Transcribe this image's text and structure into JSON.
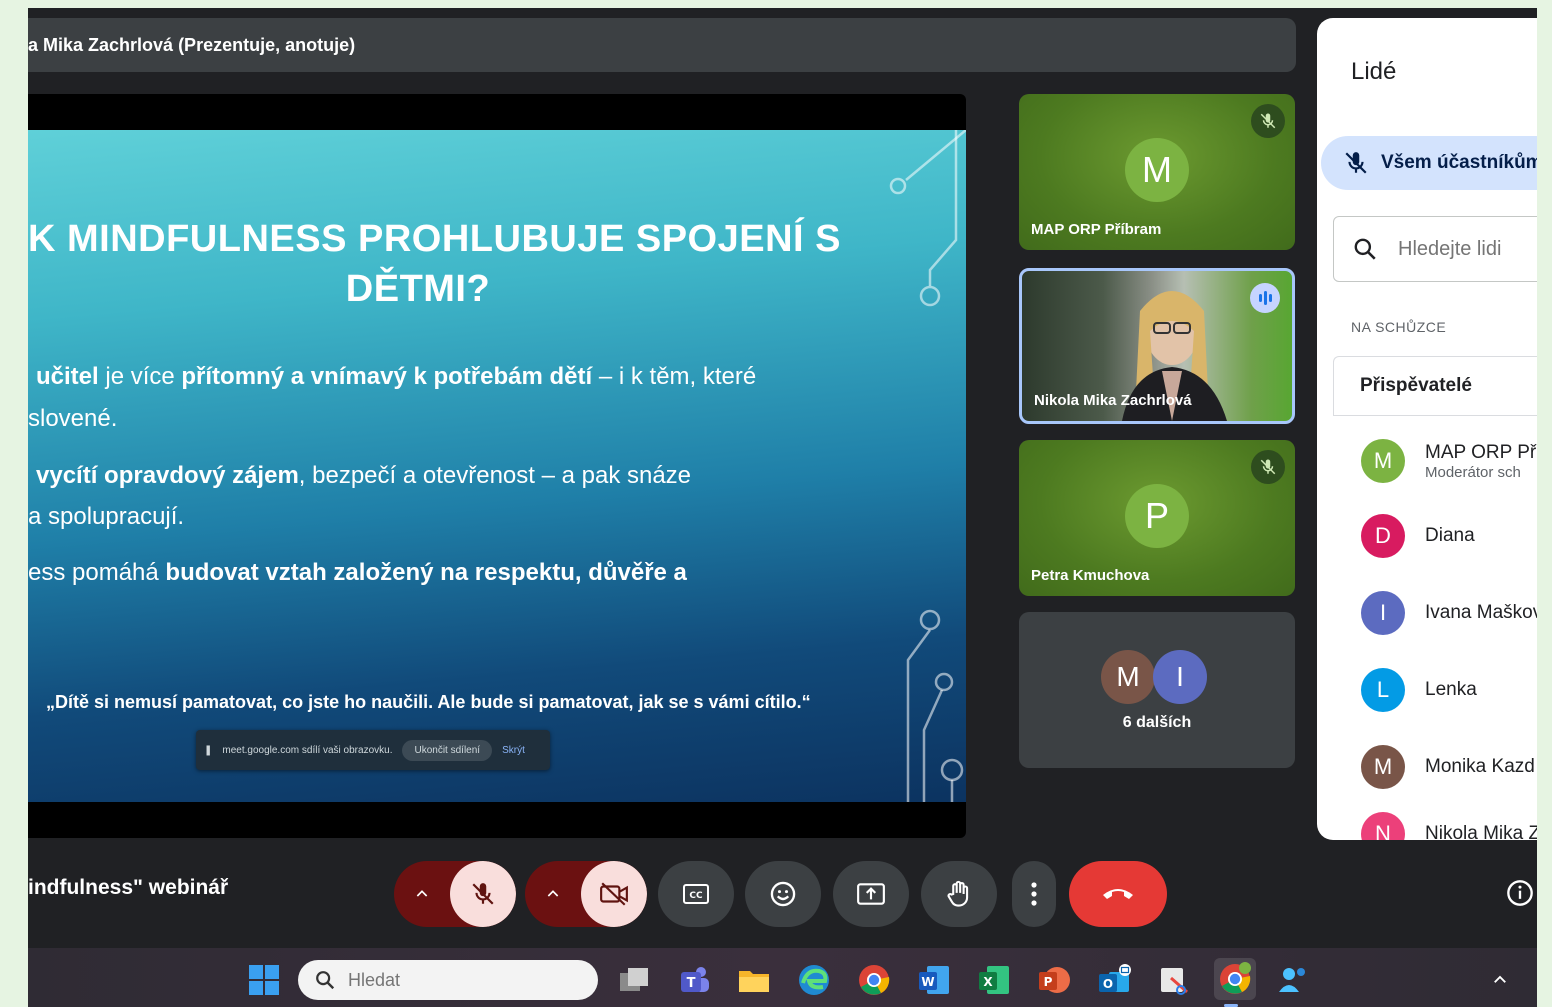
{
  "presenter_bar": {
    "text": "a Mika Zachrlová (Prezentuje, anotuje)"
  },
  "slide": {
    "title_line1": "K MINDFULNESS PROHLUBUJE SPOJENÍ S",
    "title_line2": "DĚTMI?",
    "bullets": [
      {
        "parts": [
          {
            "t": "učitel",
            "b": true
          },
          {
            "t": " je více ",
            "b": false
          },
          {
            "t": "přítomný a vnímavý k potřebám dětí",
            "b": true
          },
          {
            "t": " – i k těm, které",
            "b": false
          }
        ]
      },
      {
        "parts": [
          {
            "t": "slovené.",
            "b": false
          }
        ]
      },
      {
        "parts": [
          {
            "t": "vycítí opravdový zájem",
            "b": true
          },
          {
            "t": ", bezpečí a otevřenost – a pak snáze",
            "b": false
          }
        ]
      },
      {
        "parts": [
          {
            "t": "a spolupracují.",
            "b": false
          }
        ]
      },
      {
        "parts": [
          {
            "t": "ess pomáhá ",
            "b": false
          },
          {
            "t": "budovat vztah založený na respektu, důvěře a",
            "b": true
          }
        ]
      }
    ],
    "quote": "„Dítě si nemusí pamatovat, co jste ho naučili. Ale bude si pamatovat, jak se s vámi cítilo.“",
    "share_banner": {
      "text": "meet.google.com sdílí vaši obrazovku.",
      "stop_label": "Ukončit sdílení",
      "hide_label": "Skrýt"
    }
  },
  "tiles": {
    "map": {
      "initial": "M",
      "name": "MAP ORP Příbram",
      "avatar_color": "#7cb342"
    },
    "nikola": {
      "name": "Nikola Mika Zachrlová"
    },
    "petra": {
      "initial": "P",
      "name": "Petra Kmuchova",
      "avatar_color": "#7cb342"
    },
    "others": {
      "avatars": [
        {
          "initial": "M",
          "color": "#795548"
        },
        {
          "initial": "I",
          "color": "#5c6bc0"
        }
      ],
      "label": "6 dalších"
    }
  },
  "people_panel": {
    "title": "Lidé",
    "mute_all_label": "Všem účastníkům",
    "search_placeholder": "Hledejte lidi",
    "section_label": "NA SCHŮZCE",
    "group_label": "Přispěvatelé",
    "people": [
      {
        "initial": "M",
        "name": "MAP ORP Příl",
        "sub": "Moderátor sch",
        "color": "#7cb342"
      },
      {
        "initial": "D",
        "name": "Diana",
        "sub": "",
        "color": "#d81b60"
      },
      {
        "initial": "I",
        "name": "Ivana Maškov",
        "sub": "",
        "color": "#5c6bc0"
      },
      {
        "initial": "L",
        "name": "Lenka",
        "sub": "",
        "color": "#039be5"
      },
      {
        "initial": "M",
        "name": "Monika Kazd",
        "sub": "",
        "color": "#795548"
      },
      {
        "initial": "N",
        "name": "Nikola Mika Z",
        "sub": "",
        "color": "#ec407a"
      }
    ]
  },
  "controls": {
    "meeting_name": "indfulness\" webinář"
  },
  "taskbar": {
    "search_placeholder": "Hledat"
  },
  "colors": {
    "meet_bg": "#202124",
    "tile_green": "#4d7a20",
    "end_call_red": "#e53935",
    "muted_bg": "#f9dedc",
    "panel_accent": "#d3e3fd"
  }
}
